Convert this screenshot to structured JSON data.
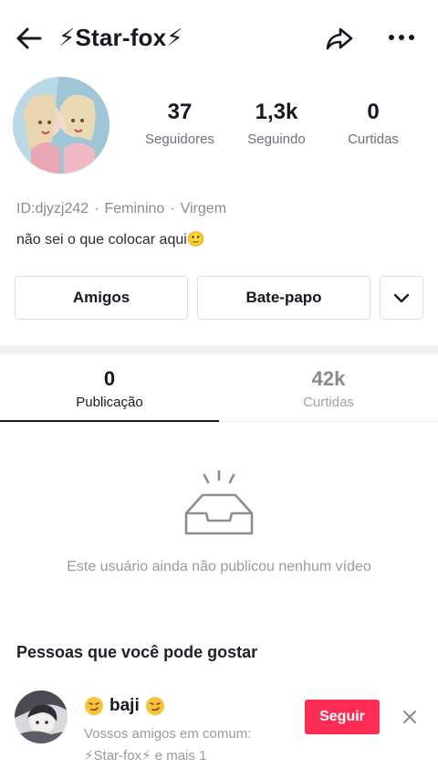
{
  "header": {
    "title": "⚡Star-fox⚡",
    "back_icon": "arrow-left-icon",
    "share_icon": "share-icon",
    "more_icon": "more-horizontal-icon"
  },
  "profile": {
    "stats": [
      {
        "value": "37",
        "label": "Seguidores"
      },
      {
        "value": "1,3k",
        "label": "Seguindo"
      },
      {
        "value": "0",
        "label": "Curtidas"
      }
    ],
    "meta": {
      "id": "ID:djyzj242",
      "gender": "Feminino",
      "sign": "Virgem",
      "separator": "·"
    },
    "bio": "não sei o que colocar aqui🙂"
  },
  "actions": {
    "friends_label": "Amigos",
    "chat_label": "Bate-papo",
    "more_icon": "chevron-down-icon"
  },
  "tabs": [
    {
      "value": "0",
      "label": "Publicação",
      "active": true
    },
    {
      "value": "42k",
      "label": "Curtidas",
      "active": false
    }
  ],
  "empty_state": {
    "icon": "empty-inbox-icon",
    "text": "Este usuário ainda não publicou nenhum vídeo"
  },
  "suggestions": {
    "title": "Pessoas que você pode gostar",
    "items": [
      {
        "name": "baji",
        "line1": "Vossos amigos em comum:",
        "line2": "⚡Star-fox⚡ e mais 1",
        "follow_label": "Seguir"
      }
    ]
  },
  "colors": {
    "accent": "#fe2c55",
    "text_primary": "#161823",
    "text_secondary": "#8a8b91",
    "divider": "#f1f1f2"
  }
}
